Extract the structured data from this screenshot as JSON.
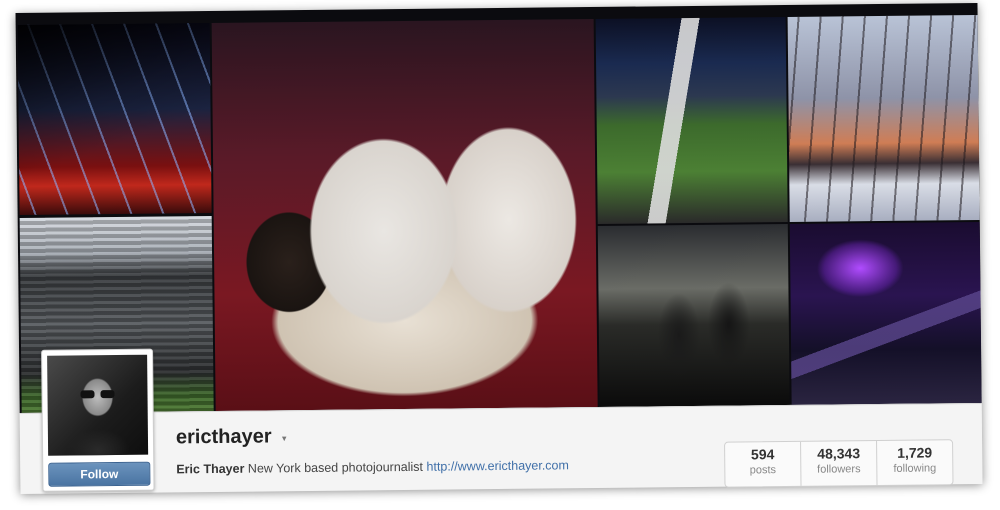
{
  "profile": {
    "username": "ericthayer",
    "full_name": "Eric Thayer",
    "bio_text": "New York based photojournalist",
    "website": "http://www.ericthayer.com",
    "follow_label": "Follow",
    "menu_caret": "▾"
  },
  "stats": [
    {
      "value": "594",
      "label": "posts"
    },
    {
      "value": "48,343",
      "label": "followers"
    },
    {
      "value": "1,729",
      "label": "following"
    }
  ],
  "cover_photos": [
    {
      "subject": "stadium-light-show"
    },
    {
      "subject": "french-bulldogs-in-bed"
    },
    {
      "subject": "football-field"
    },
    {
      "subject": "bare-trees-snow-sunset"
    },
    {
      "subject": "stadium-wide-view"
    },
    {
      "subject": "silhouetted-crowd"
    },
    {
      "subject": "runway-model-purple-lights"
    }
  ],
  "colors": {
    "follow_button": "#4a74a2",
    "link": "#3f6fa8"
  }
}
